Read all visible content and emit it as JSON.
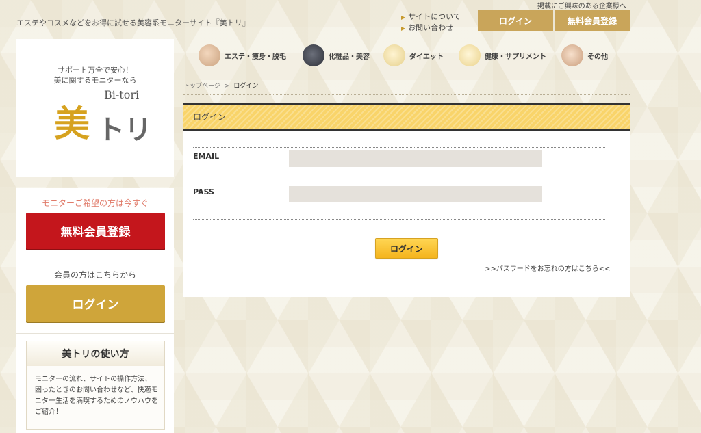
{
  "header": {
    "tagline": "エステやコスメなどをお得に試せる美容系モニターサイト『美トリ』",
    "advertiser_link": "掲載にご興味のある企業様へ",
    "nav_links": [
      "サイトについて",
      "お問い合わせ"
    ],
    "login_label": "ログイン",
    "register_label": "無料会員登録"
  },
  "sidebar": {
    "logo_sub1": "サポート万全で安心！",
    "logo_sub2": "美に関するモニターなら",
    "logo_bi_tori": "Bi-tori",
    "logo_kanji": "美",
    "logo_kana": "トリ",
    "member_prompt": "モニターご希望の方は今すぐ",
    "register_label": "無料会員登録",
    "member_note": "会員の方はこちらから",
    "login_label": "ログイン",
    "howto_title": "美トリの使い方",
    "howto_text": "モニターの流れ、サイトの操作方法、困ったときのお問い合わせなど、快適モニター生活を満喫するためのノウハウをご紹介！"
  },
  "categories": [
    {
      "label": "エステ・痩身・脱毛",
      "icon": "esthe-icon"
    },
    {
      "label": "化粧品・美容",
      "icon": "cosmetics-icon"
    },
    {
      "label": "ダイエット",
      "icon": "diet-icon"
    },
    {
      "label": "健康・サプリメント",
      "icon": "supplement-icon"
    },
    {
      "label": "その他",
      "icon": "other-icon"
    }
  ],
  "breadcrumb": {
    "top": "トップページ",
    "separator": ">",
    "current": "ログイン"
  },
  "login_form": {
    "heading": "ログイン",
    "email_label": "EMAIL",
    "email_value": "",
    "pass_label": "PASS",
    "pass_value": "",
    "submit_label": "ログイン",
    "forgot_link": ">>パスワードをお忘れの方はこちら<<"
  },
  "colors": {
    "gold": "#c9a55a",
    "red": "#c4161c",
    "yellow": "#f9d46a"
  }
}
